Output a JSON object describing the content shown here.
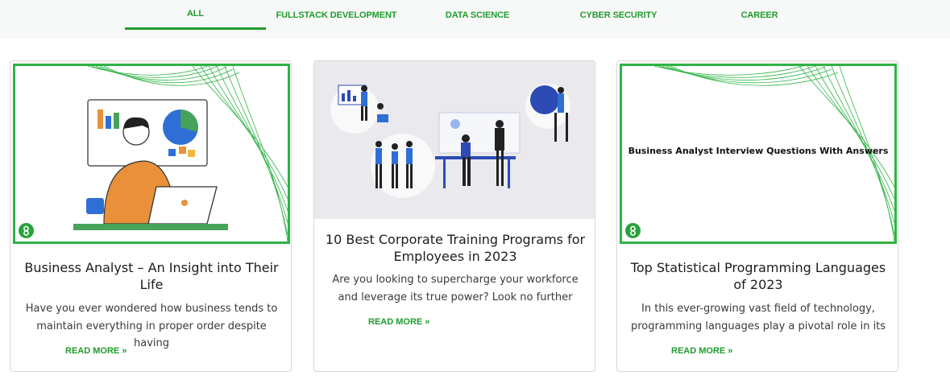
{
  "tabs": [
    {
      "label": "ALL",
      "active": true
    },
    {
      "label": "FULLSTACK DEVELOPMENT",
      "active": false
    },
    {
      "label": "DATA SCIENCE",
      "active": false
    },
    {
      "label": "CYBER SECURITY",
      "active": false
    },
    {
      "label": "CAREER",
      "active": false
    }
  ],
  "accent_color": "#1f9c2c",
  "cards": [
    {
      "title": "Business Analyst – An Insight into Their Life",
      "excerpt": "Have you ever wondered how business tends to maintain everything in proper order despite having",
      "read_more": "READ MORE »",
      "image_icon": "business-analyst-illustration"
    },
    {
      "title": "10 Best Corporate Training Programs for Employees in 2023",
      "excerpt": "Are you looking to supercharge your workforce and leverage its true power? Look no further",
      "read_more": "READ MORE »",
      "image_icon": "corporate-training-illustration"
    },
    {
      "title": "Top Statistical Programming Languages of 2023",
      "excerpt": "In this ever-growing vast field of technology, programming languages play a pivotal role in its",
      "read_more": "READ MORE »",
      "image_caption": "Business Analyst Interview Questions With Answers"
    }
  ]
}
